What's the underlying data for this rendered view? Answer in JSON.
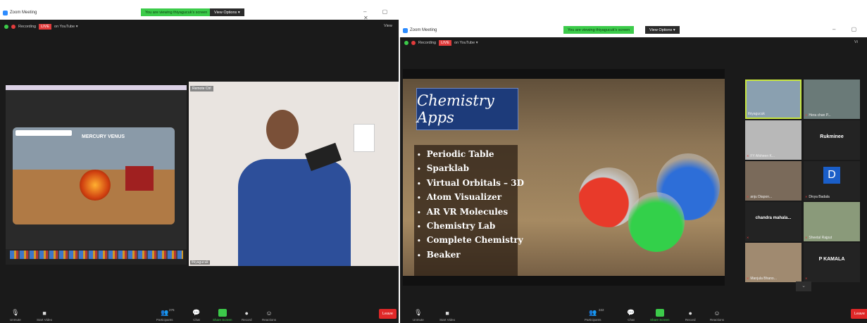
{
  "left_window": {
    "title": "Zoom Meeting",
    "viewing_banner": "You are viewing thiyagucuk's screen",
    "view_options": "View Options ▾",
    "recording": "Recording",
    "live": "LIVE",
    "stream_target": "on YouTube ▾",
    "view_button": "View",
    "remote_label": "Remote Ctrl",
    "ar_label": "MERCURY VENUS",
    "speaker_name": "thiyagucuk",
    "toolbar": {
      "unmute": "Unmute",
      "start_video": "Start Video",
      "participants": "Participants",
      "participants_count": "276",
      "chat": "Chat",
      "share": "Share Screen",
      "record": "Record",
      "reactions": "Reactions",
      "leave": "Leave"
    }
  },
  "right_window": {
    "title": "Zoom Meeting",
    "viewing_banner": "You are viewing thiyagucuk's screen",
    "view_options": "View Options ▾",
    "recording": "Recording",
    "live": "LIVE",
    "stream_target": "on YouTube ▾",
    "view_button": "Vi",
    "slide": {
      "title": "Chemistry Apps",
      "items": [
        "Periodic Table",
        "Sparklab",
        "Virtual Orbitals – 3D",
        "Atom Visualizer",
        "AR VR Molecules",
        "Chemistry Lab",
        "Complete Chemistry",
        "Beaker"
      ]
    },
    "participants": [
      {
        "name": "thiyagucuk",
        "text": ""
      },
      {
        "name": "Hera chan P...",
        "text": ""
      },
      {
        "name": "FY Afsheen K...",
        "text": ""
      },
      {
        "name": "",
        "text": "Rukminee"
      },
      {
        "name": "anju Diapon...",
        "text": ""
      },
      {
        "name": "Divya Badala",
        "text": "D"
      },
      {
        "name": "",
        "text": "chandra  mahala..."
      },
      {
        "name": "Sheetal Rajput",
        "text": ""
      },
      {
        "name": "Manjula Bhano...",
        "text": ""
      },
      {
        "name": "",
        "text": "P KAMALA"
      }
    ],
    "toolbar": {
      "unmute": "Unmute",
      "start_video": "Start Video",
      "participants": "Participants",
      "participants_count": "222",
      "chat": "Chat",
      "share": "Share Screen",
      "record": "Record",
      "reactions": "Reactions",
      "leave": "Leave"
    }
  }
}
